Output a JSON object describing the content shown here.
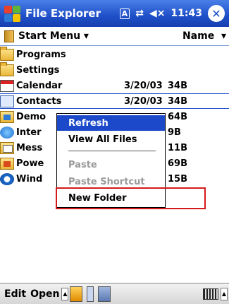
{
  "titlebar": {
    "title": "File Explorer",
    "ime_indicator": "A",
    "connectivity_icon": "⇄",
    "volume_icon": "◀×",
    "time": "11:43",
    "close_label": "✕"
  },
  "folderbar": {
    "current_folder": "Start Menu",
    "sort_by": "Name"
  },
  "files": [
    {
      "name": "Programs",
      "date": "",
      "size": "",
      "icon": "folder-icon"
    },
    {
      "name": "Settings",
      "date": "",
      "size": "",
      "icon": "folder-icon"
    },
    {
      "name": "Calendar",
      "date": "3/20/03",
      "size": "34B",
      "icon": "calendar-icon"
    },
    {
      "name": "Contacts",
      "date": "3/20/03",
      "size": "34B",
      "icon": "contacts-icon"
    },
    {
      "name": "Demo",
      "date": "",
      "size": "64B",
      "icon": "program-icon"
    },
    {
      "name": "Inter",
      "date": "",
      "size": "9B",
      "icon": "internet-explorer-icon"
    },
    {
      "name": "Mess",
      "date": "",
      "size": "11B",
      "icon": "messaging-icon"
    },
    {
      "name": "Powe",
      "date": "",
      "size": "69B",
      "icon": "powerpoint-icon"
    },
    {
      "name": "Wind",
      "date": "",
      "size": "15B",
      "icon": "windows-media-icon"
    }
  ],
  "context_menu": {
    "refresh": "Refresh",
    "view_all_files": "View All Files",
    "paste": "Paste",
    "paste_shortcut": "Paste Shortcut",
    "new_folder": "New Folder"
  },
  "bottombar": {
    "edit": "Edit",
    "open": "Open"
  },
  "colors": {
    "titlebar_blue": "#1f4fc8",
    "highlight_blue": "#1c49c9",
    "annotation_red": "#d41a1a"
  }
}
